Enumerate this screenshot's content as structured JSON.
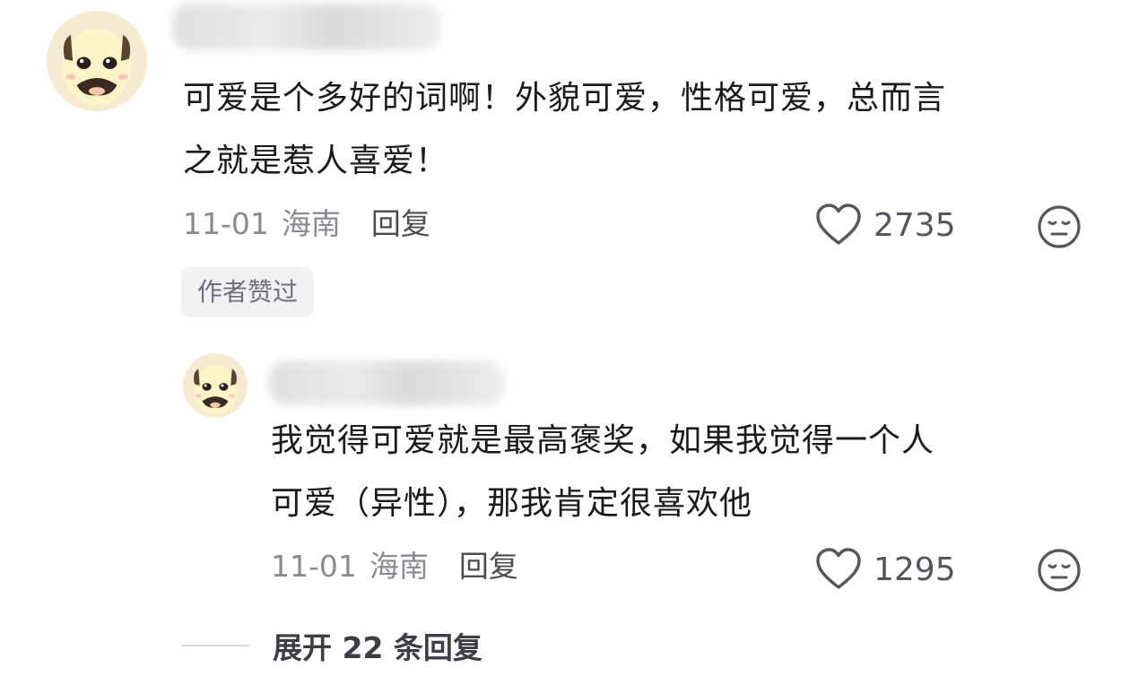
{
  "comments": [
    {
      "text_lines": [
        "可爱是个多好的词啊！外貌可爱，性格可爱，总而言",
        "之就是惹人喜爱！"
      ],
      "date": "11-01",
      "location": "海南",
      "reply_label": "回复",
      "likes": "2735",
      "badge": "作者赞过",
      "like_icon": "heart-outline-icon",
      "dislike_icon": "neutral-face-icon"
    },
    {
      "text_lines": [
        "我觉得可爱就是最高褒奖，如果我觉得一个人",
        "可爱（异性），那我肯定很喜欢他"
      ],
      "date": "11-01",
      "location": "海南",
      "reply_label": "回复",
      "likes": "1295",
      "like_icon": "heart-outline-icon",
      "dislike_icon": "neutral-face-icon"
    }
  ],
  "expand_replies": {
    "label": "展开 22 条回复"
  },
  "colors": {
    "text": "#1a1a1a",
    "meta": "#8a8b91",
    "badge_bg": "#f2f2f4",
    "avatar_bg": "#f4ecd4"
  }
}
